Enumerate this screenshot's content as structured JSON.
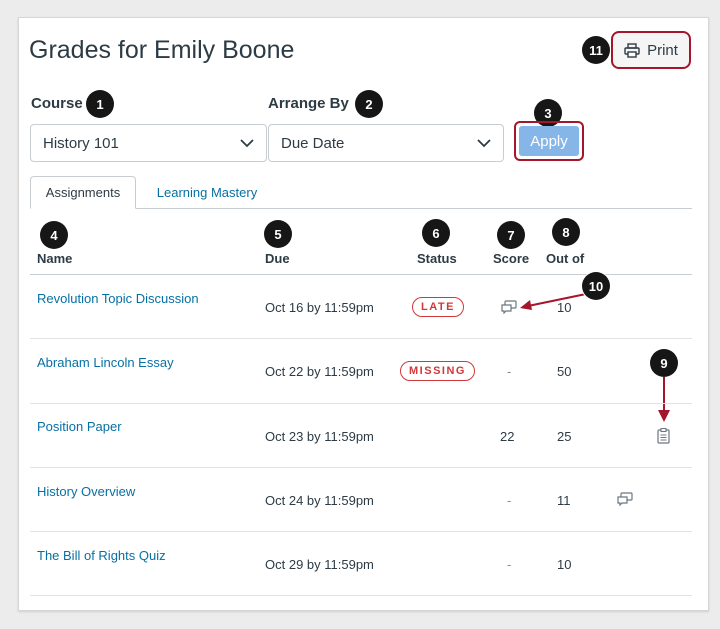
{
  "page": {
    "title": "Grades for Emily Boone",
    "print_label": "Print"
  },
  "filters": {
    "course_label": "Course",
    "course_value": "History 101",
    "arrange_label": "Arrange By",
    "arrange_value": "Due Date",
    "apply_label": "Apply"
  },
  "tabs": [
    {
      "label": "Assignments"
    },
    {
      "label": "Learning Mastery"
    }
  ],
  "columns": {
    "name": "Name",
    "due": "Due",
    "status": "Status",
    "score": "Score",
    "out_of": "Out of"
  },
  "rows": [
    {
      "name": "Revolution Topic Discussion",
      "due": "Oct 16 by 11:59pm",
      "status": "LATE",
      "score_icon": "comment-icon",
      "out_of": "10"
    },
    {
      "name": "Abraham Lincoln Essay",
      "due": "Oct 22 by 11:59pm",
      "status": "MISSING",
      "score": "-",
      "out_of": "50"
    },
    {
      "name": "Position Paper",
      "due": "Oct 23 by 11:59pm",
      "status": "",
      "score": "22",
      "out_of": "25",
      "extra_icon": "rubric-icon"
    },
    {
      "name": "History Overview",
      "due": "Oct 24 by 11:59pm",
      "status": "",
      "score": "-",
      "out_of": "11",
      "extra_icon": "comment-icon"
    },
    {
      "name": "The Bill of Rights Quiz",
      "due": "Oct 29 by 11:59pm",
      "status": "",
      "score": "-",
      "out_of": "10"
    }
  ],
  "callouts": [
    "1",
    "2",
    "3",
    "4",
    "5",
    "6",
    "7",
    "8",
    "9",
    "10",
    "11"
  ],
  "colors": {
    "link": "#0770a3",
    "danger": "#d1383a",
    "callout_border": "#a4162c",
    "apply_bg": "#86b6e8"
  }
}
